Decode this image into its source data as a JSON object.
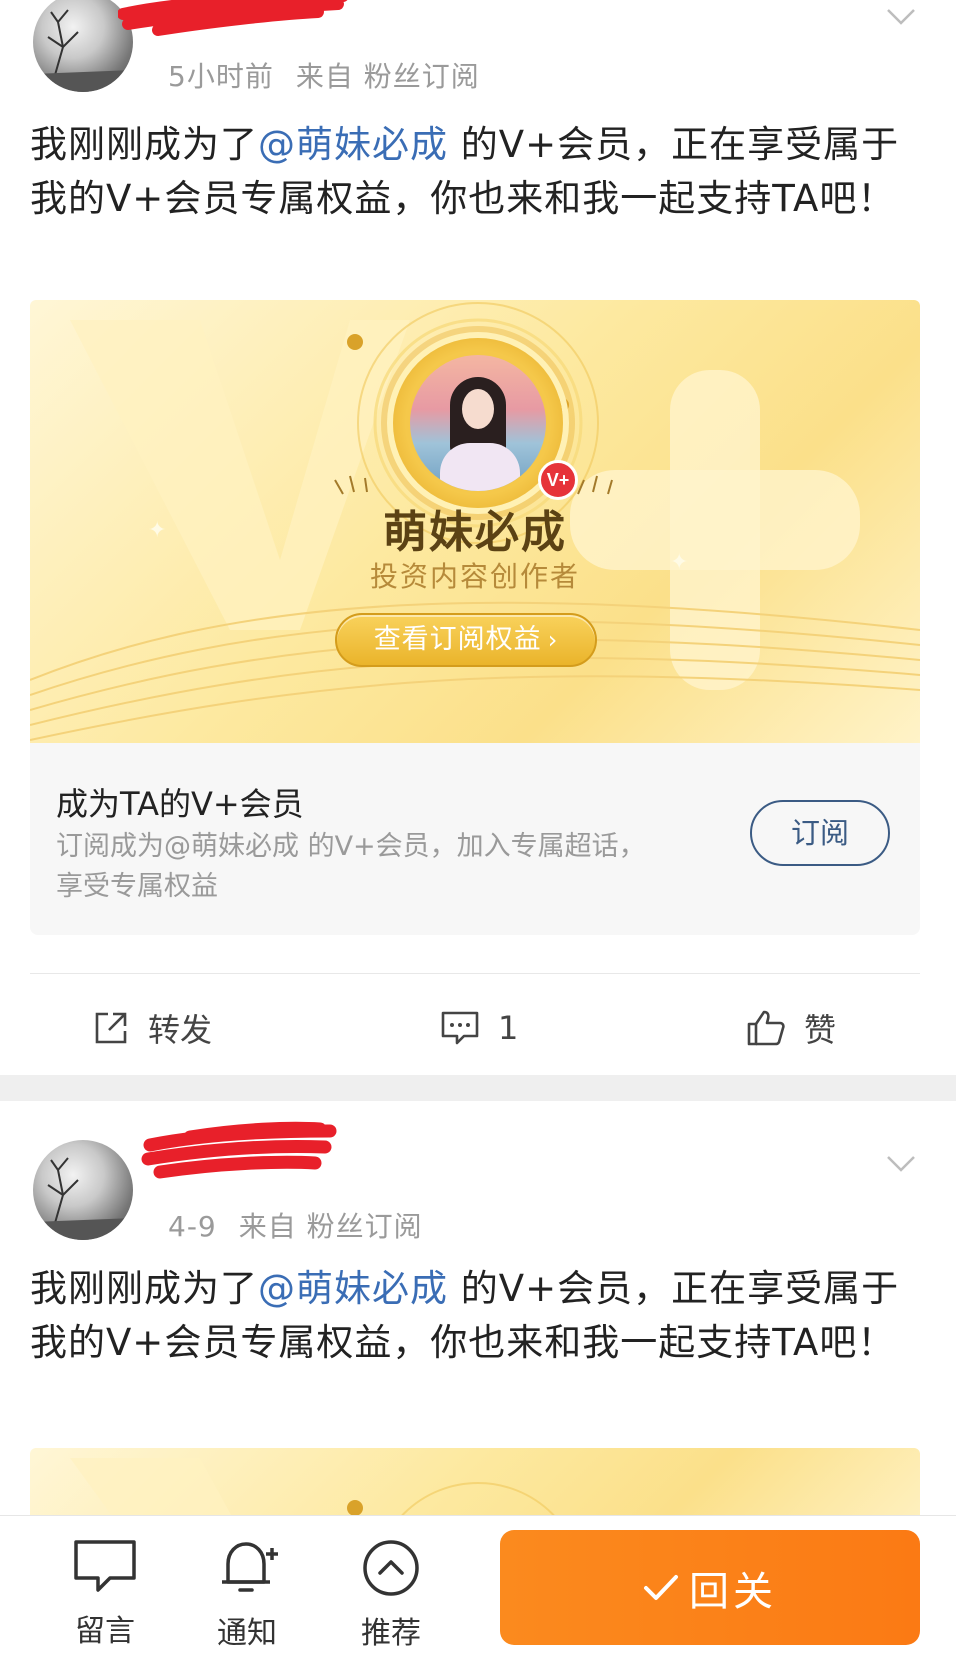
{
  "posts": [
    {
      "meta": {
        "time": "5小时前",
        "source": "来自 粉丝订阅"
      },
      "text": {
        "before": "我刚刚成为了",
        "mention": "@萌妹必成",
        "after": " 的V+会员，正在享受属于我的V+会员专属权益，你也来和我一起支持TA吧！"
      },
      "card": {
        "creator_name": "萌妹必成",
        "creator_role": "投资内容创作者",
        "badge": "V+",
        "cta": "查看订阅权益",
        "cta_arrow": "›"
      },
      "subscribe": {
        "title": "成为TA的V+会员",
        "desc": "订阅成为@萌妹必成 的V+会员，加入专属超话，享受专属权益",
        "button": "订阅"
      },
      "actions": {
        "repost": "转发",
        "comment": "1",
        "like": "赞"
      }
    },
    {
      "meta": {
        "time": "4-9",
        "source": "来自 粉丝订阅"
      },
      "text": {
        "before": "我刚刚成为了",
        "mention": "@萌妹必成",
        "after": " 的V+会员，正在享受属于我的V+会员专属权益，你也来和我一起支持TA吧！"
      }
    }
  ],
  "bottom_bar": {
    "comment": "留言",
    "notify": "通知",
    "recommend": "推荐",
    "follow_back": "回关"
  },
  "colors": {
    "mention": "#3a6db5",
    "follow_back": "#fb7a14",
    "redaction": "#e8202a"
  }
}
